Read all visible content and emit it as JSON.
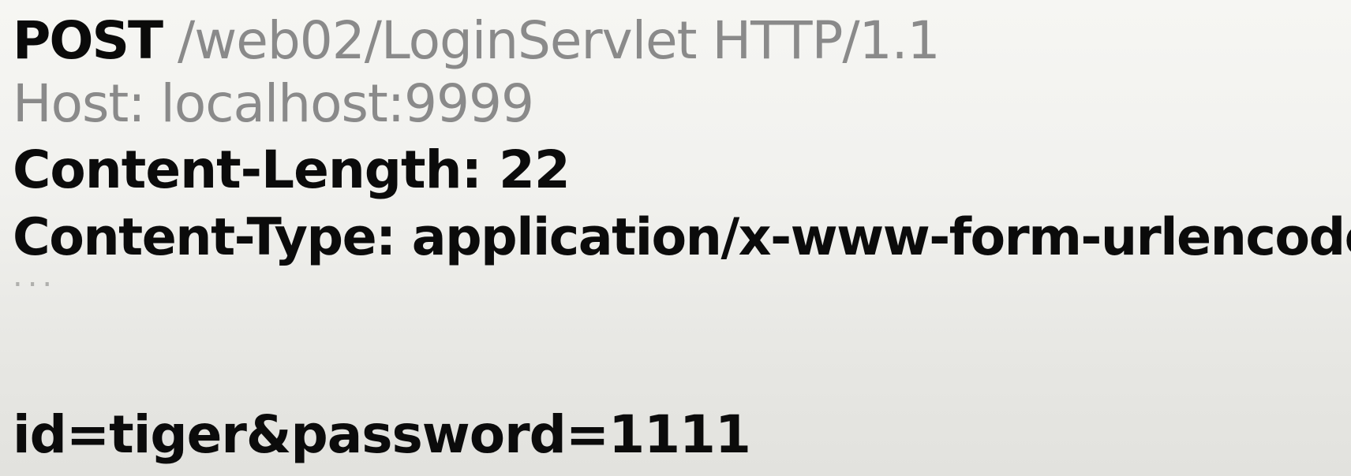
{
  "request_line": {
    "method": "POST",
    "path_and_version": "/web02/LoginServlet HTTP/1.1"
  },
  "headers": {
    "host": "Host: localhost:9999",
    "content_length": "Content-Length: 22",
    "content_type": "Content-Type: application/x-www-form-urlencoded"
  },
  "ellipsis": "...",
  "body": "id=tiger&password=1111",
  "colors": {
    "primary_text": "#0b0b0b",
    "dim_text": "#8a8a8a",
    "ellipsis": "#b0b0ad",
    "background": "#f1f1ee"
  }
}
